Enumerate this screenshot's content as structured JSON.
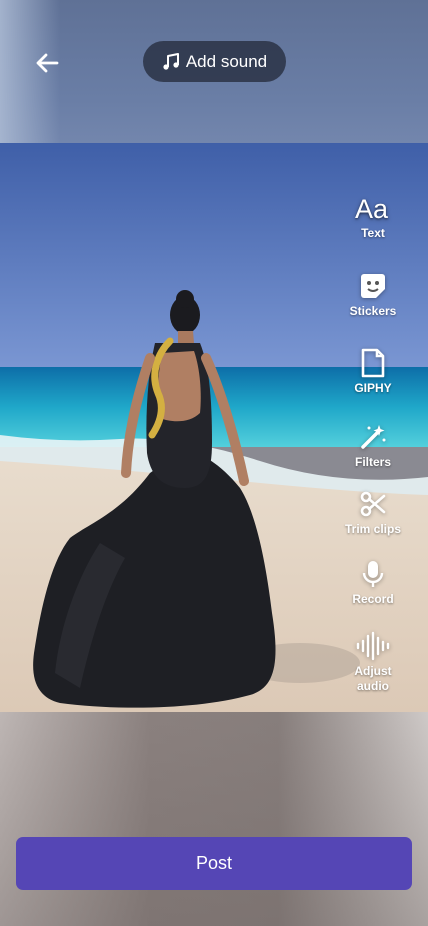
{
  "header": {
    "back_icon": "arrow-left-icon",
    "add_sound": {
      "icon": "music-note-icon",
      "label": "Add sound"
    }
  },
  "tools": [
    {
      "id": "text",
      "icon": "text-aa-icon",
      "label": "Text"
    },
    {
      "id": "stickers",
      "icon": "sticker-icon",
      "label": "Stickers"
    },
    {
      "id": "giphy",
      "icon": "giphy-icon",
      "label": "GIPHY"
    },
    {
      "id": "filters",
      "icon": "magic-wand-icon",
      "label": "Filters"
    },
    {
      "id": "trim",
      "icon": "scissors-icon",
      "label": "Trim clips"
    },
    {
      "id": "record",
      "icon": "microphone-icon",
      "label": "Record"
    },
    {
      "id": "adjust_audio",
      "icon": "waveform-icon",
      "label": "Adjust audio"
    }
  ],
  "post": {
    "label": "Post"
  },
  "colors": {
    "accent": "#5546b5",
    "pill": "#283042"
  }
}
